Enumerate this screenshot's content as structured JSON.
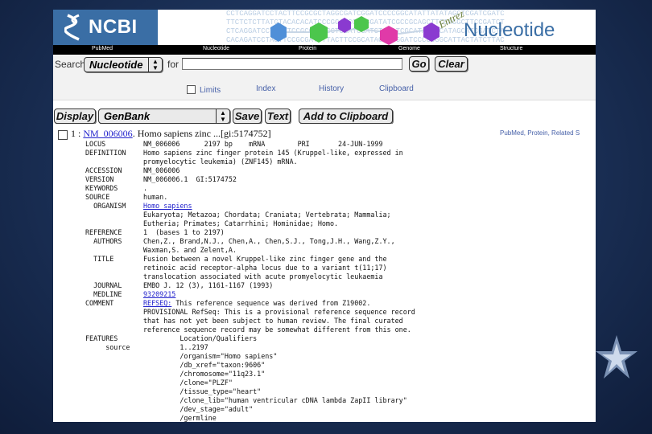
{
  "banner": {
    "logo_text": "NCBI",
    "product": "Nucleotide",
    "entrez_label": "Entrez",
    "dna_lines": [
      "CCTCAGGATCCTACTTCCGCGCTAGGCGATCGGATCCCCGGCATATTATATAGCTCGATCGATC",
      "TTCTCTCTTATGTACACACATCCCGGATCGCAGGATATCGCCGCAGCTTCCAGGCTTCCGATCT",
      "CTCAGGATCCTACTTCCGCGCGCGCTCGATCGATCTCGATCGCATATAGCATAGCATCGATCTA",
      "CACAGATCCTACTTCCGCGATCTTACTTCCGCATACGTCGGATCCCCCGGCATTACTATCTTAC"
    ],
    "colors": {
      "logo_bg": "#3a6ea5",
      "hex_blue": "#4f8fd8",
      "hex_green": "#4cc64c",
      "hex_pink": "#e03aa8",
      "hex_purple": "#8a3ad0"
    }
  },
  "nav": {
    "items": [
      "PubMed",
      "Nucleotide",
      "Protein",
      "Genome",
      "Structure"
    ]
  },
  "search": {
    "label": "Search",
    "database": "Nucleotide",
    "for_label": "for",
    "query": "",
    "go_label": "Go",
    "clear_label": "Clear",
    "limits_label": "Limits",
    "index_label": "Index",
    "history_label": "History",
    "clipboard_label": "Clipboard"
  },
  "display_bar": {
    "display_label": "Display",
    "format": "GenBank",
    "save_label": "Save",
    "text_label": "Text",
    "add_clipboard_label": "Add to Clipboard"
  },
  "record": {
    "number": "1 :",
    "accession_link": "NM_006006",
    "title_rest": ". Homo sapiens zinc ...[gi:5174752]",
    "related_links": "PubMed, Protein, Related S",
    "genbank_lines": [
      {
        "k": "LOCUS",
        "v": "NM_006006      2197 bp    mRNA        PRI       24-JUN-1999"
      },
      {
        "k": "DEFINITION",
        "v": "Homo sapiens zinc finger protein 145 (Kruppel-like, expressed in"
      },
      {
        "k": "",
        "v": "promyelocytic leukemia) (ZNF145) mRNA."
      },
      {
        "k": "ACCESSION",
        "v": "NM_006006"
      },
      {
        "k": "VERSION",
        "v": "NM_006006.1  GI:5174752"
      },
      {
        "k": "KEYWORDS",
        "v": "."
      },
      {
        "k": "SOURCE",
        "v": "human."
      },
      {
        "k": "  ORGANISM",
        "v": "",
        "link": "Homo sapiens"
      },
      {
        "k": "",
        "v": "Eukaryota; Metazoa; Chordata; Craniata; Vertebrata; Mammalia;"
      },
      {
        "k": "",
        "v": "Eutheria; Primates; Catarrhini; Hominidae; Homo."
      },
      {
        "k": "REFERENCE",
        "v": "1  (bases 1 to 2197)"
      },
      {
        "k": "  AUTHORS",
        "v": "Chen,Z., Brand,N.J., Chen,A., Chen,S.J., Tong,J.H., Wang,Z.Y.,"
      },
      {
        "k": "",
        "v": "Waxman,S. and Zelent,A."
      },
      {
        "k": "  TITLE",
        "v": "Fusion between a novel Kruppel-like zinc finger gene and the"
      },
      {
        "k": "",
        "v": "retinoic acid receptor-alpha locus due to a variant t(11;17)"
      },
      {
        "k": "",
        "v": "translocation associated with acute promyelocytic leukaemia"
      },
      {
        "k": "  JOURNAL",
        "v": "EMBO J. 12 (3), 1161-1167 (1993)"
      },
      {
        "k": "  MEDLINE",
        "v": "",
        "link": "93209215"
      },
      {
        "k": "COMMENT",
        "v": " This reference sequence was derived from Z19002.",
        "link": "REFSEQ:"
      },
      {
        "k": "",
        "v": "PROVISIONAL RefSeq: This is a provisional reference sequence record"
      },
      {
        "k": "",
        "v": "that has not yet been subject to human review. The final curated"
      },
      {
        "k": "",
        "v": "reference sequence record may be somewhat different from this one."
      },
      {
        "k": "FEATURES",
        "v": "         Location/Qualifiers"
      },
      {
        "k": "     source",
        "v": "         1..2197"
      },
      {
        "k": "",
        "v": "         /organism=\"Homo sapiens\""
      },
      {
        "k": "",
        "v": "         /db_xref=\"taxon:9606\""
      },
      {
        "k": "",
        "v": "         /chromosome=\"11q23.1\""
      },
      {
        "k": "",
        "v": "         /clone=\"PLZF\""
      },
      {
        "k": "",
        "v": "         /tissue_type=\"heart\""
      },
      {
        "k": "",
        "v": "         /clone_lib=\"human ventricular cDNA lambda ZapII library\""
      },
      {
        "k": "",
        "v": "         /dev_stage=\"adult\""
      },
      {
        "k": "",
        "v": "         /germline"
      }
    ]
  }
}
